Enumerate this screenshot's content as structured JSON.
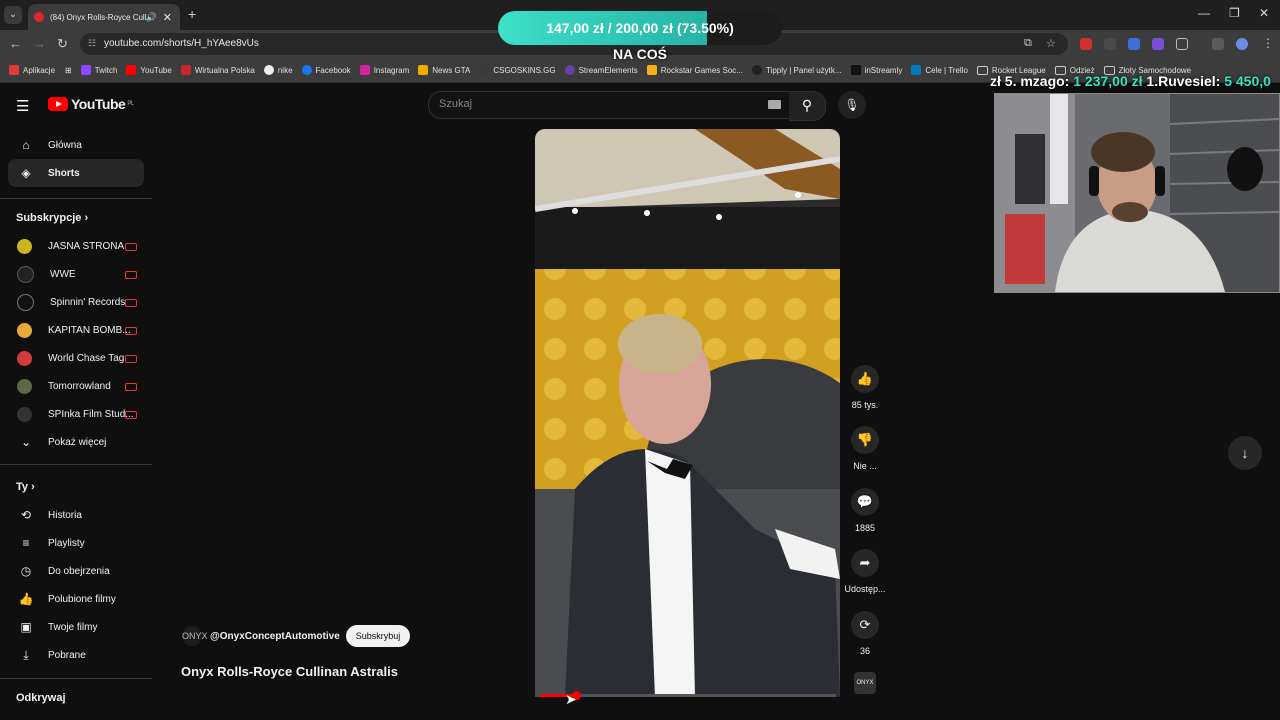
{
  "browser": {
    "tab_title": "(84) Onyx Rolls-Royce Culli",
    "url": "youtube.com/shorts/H_hYAee8vUs",
    "bookmarks": [
      "Aplikacje",
      "Twitch",
      "YouTube",
      "Wirtualna Polska",
      "nike",
      "Facebook",
      "Instagram",
      "News GTA",
      "CSGOSKINS.GG",
      "StreamElements",
      "Rockstar Games Soc...",
      "Tipply | Panel użytk...",
      "inStreamly",
      "Cele | Trello",
      "Rocket League",
      "Odzież",
      "Złoty Samochodowe"
    ]
  },
  "overlay": {
    "donation_goal_text": "147,00 zł  /  200,00 zł (73.50%)",
    "donation_progress": 0.735,
    "donation_caption": "NA COŚ",
    "top_donors_prefix": "zł 5. mzago: ",
    "top_donors_amount1": "1 237,00 zł",
    "top_donors_mid": " 1.Ruvesiel: ",
    "top_donors_amount2": "5 450,0"
  },
  "youtube": {
    "logo_text": "YouTube",
    "logo_country": "PL",
    "search_placeholder": "Szukaj",
    "nav": {
      "home": "Główna",
      "shorts": "Shorts"
    },
    "subscriptions_heading": "Subskrypcje",
    "subscriptions": [
      {
        "name": "JASNA STRONA",
        "color": "#c9b520"
      },
      {
        "name": "WWE",
        "color": "#222222"
      },
      {
        "name": "Spinnin' Records",
        "color": "#111111"
      },
      {
        "name": "KAPITAN BOMB...",
        "color": "#e8a93b"
      },
      {
        "name": "World Chase Tag",
        "color": "#d23b3b"
      },
      {
        "name": "Tomorrowland",
        "color": "#5a6b45"
      },
      {
        "name": "SPInka Film Stud...",
        "color": "#333333"
      }
    ],
    "show_more": "Pokaż więcej",
    "you_heading": "Ty",
    "you_items": [
      "Historia",
      "Playlisty",
      "Do obejrzenia",
      "Polubione filmy",
      "Twoje filmy",
      "Pobrane"
    ],
    "explore_heading": "Odkrywaj",
    "short": {
      "channel_avatar": "ONYX",
      "channel": "@OnyxConceptAutomotive",
      "subscribe": "Subskrybuj",
      "title": "Onyx Rolls-Royce Cullinan Astralis",
      "progress": 0.12
    },
    "actions": {
      "likes": "85 tys.",
      "dislike": "Nie ...",
      "comments": "1885",
      "share": "Udostęp...",
      "remix": "36",
      "sound_label": "ONYX"
    }
  },
  "colors": {
    "yt_red": "#ff0000",
    "donation_teal": "#36e2c3"
  }
}
